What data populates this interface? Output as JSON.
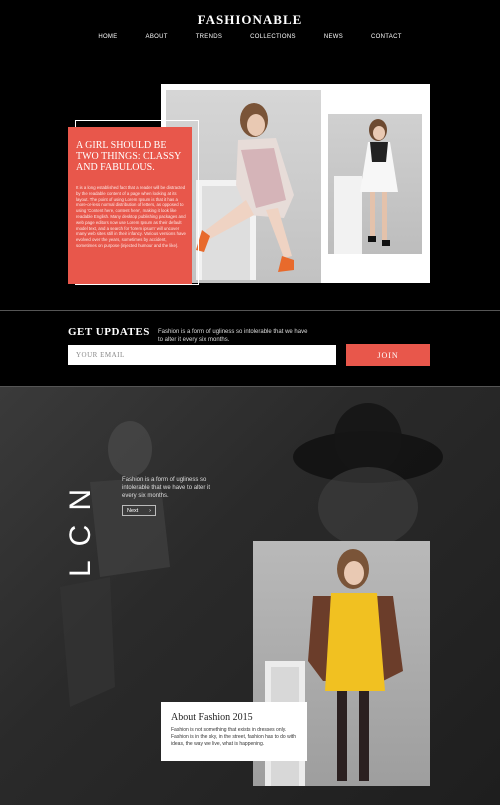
{
  "brand": "FASHIONABLE",
  "nav": [
    "HOME",
    "ABOUT",
    "TRENDS",
    "COLLECTIONS",
    "NEWS",
    "CONTACT"
  ],
  "hero": {
    "title": "A GIRL SHOULD BE TWO THINGS: CLASSY AND FABULOUS.",
    "body": "It is a long established fact that a reader will be distracted by the readable content of a page when looking at its layout. The point of using Lorem Ipsum is that it has a more-or-less normal distribution of letters, as opposed to using 'Content here, content here', making it look like readable English. Many desktop publishing packages and web page editors now use Lorem Ipsum as their default model text, and a search for 'lorem ipsum' will uncover many web sites still in their infancy. Various versions have evolved over the years, sometimes by accident, sometimes on purpose (injected humour and the like)."
  },
  "updates": {
    "title": "GET UPDATES",
    "text": "Fashion is a form of ugliness so intolerable that we have to alter it every six months.",
    "email_placeholder": "YOUR EMAIL",
    "join_label": "JOIN"
  },
  "feature": {
    "label": "LCN",
    "text": "Fashion is a form of ugliness so intolerable that we have to alter it every six months.",
    "next_label": "Next",
    "next_icon": "›"
  },
  "about": {
    "title": "About Fashion 2015",
    "body": "Fashion is not something that exists in dresses only. Fashion is in the sky, in the street, fashion has to do with ideas, the way we live, what is happening."
  },
  "colors": {
    "accent": "#e8574b",
    "background": "#000000",
    "card": "#ffffff"
  }
}
